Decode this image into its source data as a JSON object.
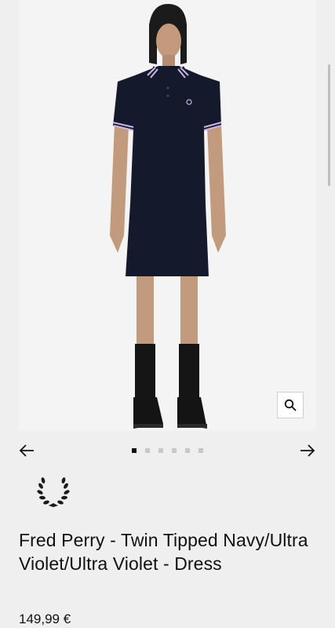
{
  "product": {
    "title": "Fred Perry - Twin Tipped Navy/Ultra Violet/Ultra Violet - Dress",
    "price": "149,99 €",
    "image_icon": "dress-model-photo"
  },
  "gallery": {
    "image_count": 6,
    "active_index": 0,
    "zoom_icon": "search-icon",
    "prev_icon": "arrow-left-icon",
    "next_icon": "arrow-right-icon"
  },
  "brand": {
    "logo_icon": "laurel-wreath-icon"
  },
  "colors": {
    "background": "#efefef",
    "image_bg": "#f4f4f4",
    "dress_navy": "#141a2b",
    "tipping_violet": "#c7b6e6",
    "text": "#111111"
  }
}
